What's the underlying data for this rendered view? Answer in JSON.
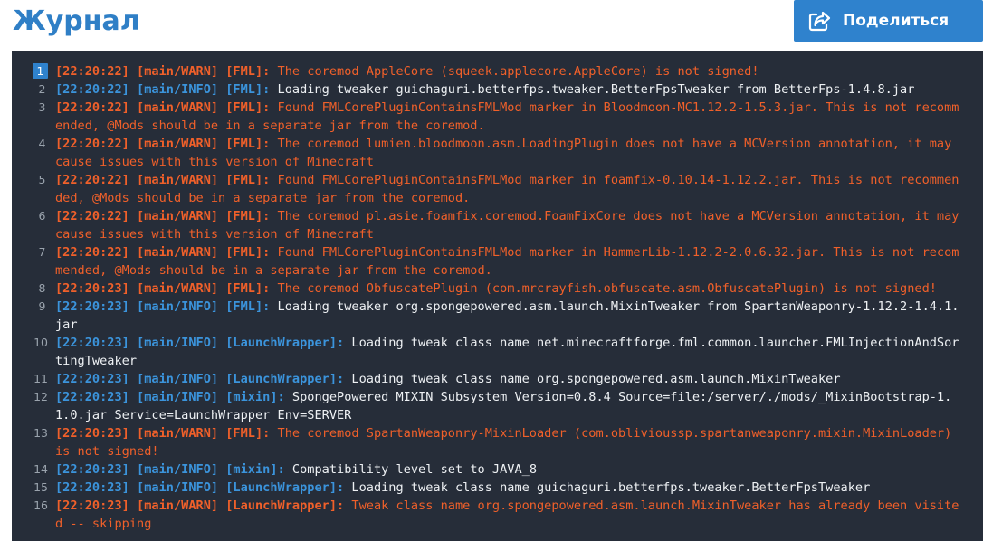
{
  "header": {
    "title": "Журнал",
    "share_label": "Поделиться"
  },
  "colors": {
    "accent": "#2f82cd",
    "panel_bg": "#262d39",
    "warn": "#f0602a",
    "info_tag": "#3b94dc",
    "info_text": "#eef1f4"
  },
  "log": {
    "lines": [
      {
        "num": "1",
        "level": "warn",
        "ts": "[22:20:22]",
        "thread": "[main/WARN]",
        "src": "[FML]:",
        "msg": "The coremod AppleCore (squeek.applecore.AppleCore) is not signed!"
      },
      {
        "num": "2",
        "level": "info",
        "ts": "[22:20:22]",
        "thread": "[main/INFO]",
        "src": "[FML]:",
        "msg": "Loading tweaker guichaguri.betterfps.tweaker.BetterFpsTweaker from BetterFps-1.4.8.jar"
      },
      {
        "num": "3",
        "level": "warn",
        "ts": "[22:20:22]",
        "thread": "[main/WARN]",
        "src": "[FML]:",
        "msg": "Found FMLCorePluginContainsFMLMod marker in Bloodmoon-MC1.12.2-1.5.3.jar. This is not recommended, @Mods should be in a separate jar from the coremod."
      },
      {
        "num": "4",
        "level": "warn",
        "ts": "[22:20:22]",
        "thread": "[main/WARN]",
        "src": "[FML]:",
        "msg": "The coremod lumien.bloodmoon.asm.LoadingPlugin does not have a MCVersion annotation, it may cause issues with this version of Minecraft"
      },
      {
        "num": "5",
        "level": "warn",
        "ts": "[22:20:22]",
        "thread": "[main/WARN]",
        "src": "[FML]:",
        "msg": "Found FMLCorePluginContainsFMLMod marker in foamfix-0.10.14-1.12.2.jar. This is not recommended, @Mods should be in a separate jar from the coremod."
      },
      {
        "num": "6",
        "level": "warn",
        "ts": "[22:20:22]",
        "thread": "[main/WARN]",
        "src": "[FML]:",
        "msg": "The coremod pl.asie.foamfix.coremod.FoamFixCore does not have a MCVersion annotation, it may cause issues with this version of Minecraft"
      },
      {
        "num": "7",
        "level": "warn",
        "ts": "[22:20:22]",
        "thread": "[main/WARN]",
        "src": "[FML]:",
        "msg": "Found FMLCorePluginContainsFMLMod marker in HammerLib-1.12.2-2.0.6.32.jar. This is not recommended, @Mods should be in a separate jar from the coremod."
      },
      {
        "num": "8",
        "level": "warn",
        "ts": "[22:20:23]",
        "thread": "[main/WARN]",
        "src": "[FML]:",
        "msg": "The coremod ObfuscatePlugin (com.mrcrayfish.obfuscate.asm.ObfuscatePlugin) is not signed!"
      },
      {
        "num": "9",
        "level": "info",
        "ts": "[22:20:23]",
        "thread": "[main/INFO]",
        "src": "[FML]:",
        "msg": "Loading tweaker org.spongepowered.asm.launch.MixinTweaker from SpartanWeaponry-1.12.2-1.4.1.jar"
      },
      {
        "num": "10",
        "level": "info",
        "ts": "[22:20:23]",
        "thread": "[main/INFO]",
        "src": "[LaunchWrapper]:",
        "msg": "Loading tweak class name net.minecraftforge.fml.common.launcher.FMLInjectionAndSortingTweaker"
      },
      {
        "num": "11",
        "level": "info",
        "ts": "[22:20:23]",
        "thread": "[main/INFO]",
        "src": "[LaunchWrapper]:",
        "msg": "Loading tweak class name org.spongepowered.asm.launch.MixinTweaker"
      },
      {
        "num": "12",
        "level": "info",
        "ts": "[22:20:23]",
        "thread": "[main/INFO]",
        "src": "[mixin]:",
        "msg": "SpongePowered MIXIN Subsystem Version=0.8.4 Source=file:/server/./mods/_MixinBootstrap-1.1.0.jar Service=LaunchWrapper Env=SERVER"
      },
      {
        "num": "13",
        "level": "warn",
        "ts": "[22:20:23]",
        "thread": "[main/WARN]",
        "src": "[FML]:",
        "msg": "The coremod SpartanWeaponry-MixinLoader (com.oblivioussp.spartanweaponry.mixin.MixinLoader) is not signed!"
      },
      {
        "num": "14",
        "level": "info",
        "ts": "[22:20:23]",
        "thread": "[main/INFO]",
        "src": "[mixin]:",
        "msg": "Compatibility level set to JAVA_8"
      },
      {
        "num": "15",
        "level": "info",
        "ts": "[22:20:23]",
        "thread": "[main/INFO]",
        "src": "[LaunchWrapper]:",
        "msg": "Loading tweak class name guichaguri.betterfps.tweaker.BetterFpsTweaker"
      },
      {
        "num": "16",
        "level": "warn",
        "ts": "[22:20:23]",
        "thread": "[main/WARN]",
        "src": "[LaunchWrapper]:",
        "msg": "Tweak class name org.spongepowered.asm.launch.MixinTweaker has already been visited -- skipping"
      }
    ]
  }
}
